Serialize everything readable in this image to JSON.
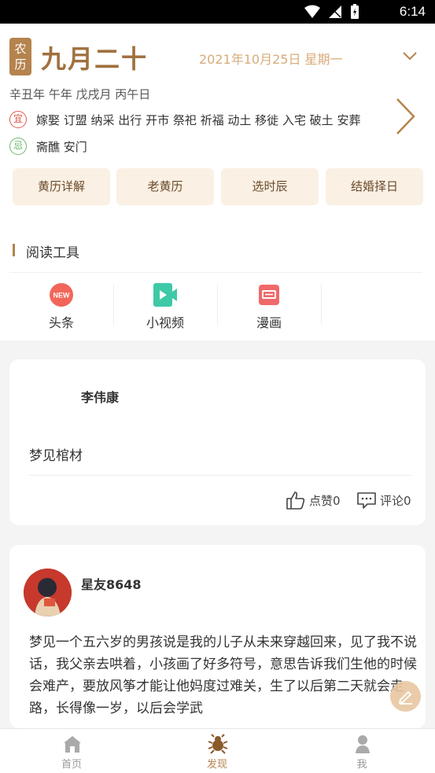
{
  "status_bar": {
    "time": "6:14"
  },
  "calendar": {
    "lunar_badge": [
      "农",
      "历"
    ],
    "lunar_date": "九月二十",
    "solar_date": "2021年10月25日 星期一",
    "ganzhi": "辛丑年 午年 戊戌月 丙午日",
    "yi_mark": "宜",
    "yi_items": "嫁娶 订盟 纳采 出行 开市 祭祀 祈福 动土 移徙 入宅 破土 安葬",
    "ji_mark": "忌",
    "ji_items": "斋醮 安门"
  },
  "quick_buttons": [
    "黄历详解",
    "老黄历",
    "选时辰",
    "结婚择日"
  ],
  "reading_tools": {
    "title": "阅读工具",
    "items": [
      {
        "label": "头条",
        "badge": "NEW",
        "icon": "news-icon"
      },
      {
        "label": "小视频",
        "icon": "video-icon"
      },
      {
        "label": "漫画",
        "icon": "comic-icon"
      }
    ]
  },
  "posts": [
    {
      "author": "李伟康",
      "content": "梦见棺材",
      "like_label": "点赞0",
      "comment_label": "评论0"
    },
    {
      "author": "星友8648",
      "content": "梦见一个五六岁的男孩说是我的儿子从未来穿越回来，见了我不说话，我父亲去哄着，小孩画了好多符号，意思告诉我们生他的时候会难产，要放风筝才能让他妈度过难关，生了以后第二天就会走路，长得像一岁，以后会学武"
    }
  ],
  "tab_bar": {
    "items": [
      {
        "label": "首页",
        "icon": "home-icon",
        "active": false
      },
      {
        "label": "发现",
        "icon": "bug-icon",
        "active": true
      },
      {
        "label": "我",
        "icon": "user-icon",
        "active": false
      }
    ]
  },
  "colors": {
    "accent": "#b5834e",
    "lunar_text": "#a0703e",
    "button_bg": "#faf0e4",
    "yi": "#e25a4a",
    "ji": "#6bb86b",
    "tab_active": "#b5834e",
    "tab_inactive": "#999999"
  }
}
